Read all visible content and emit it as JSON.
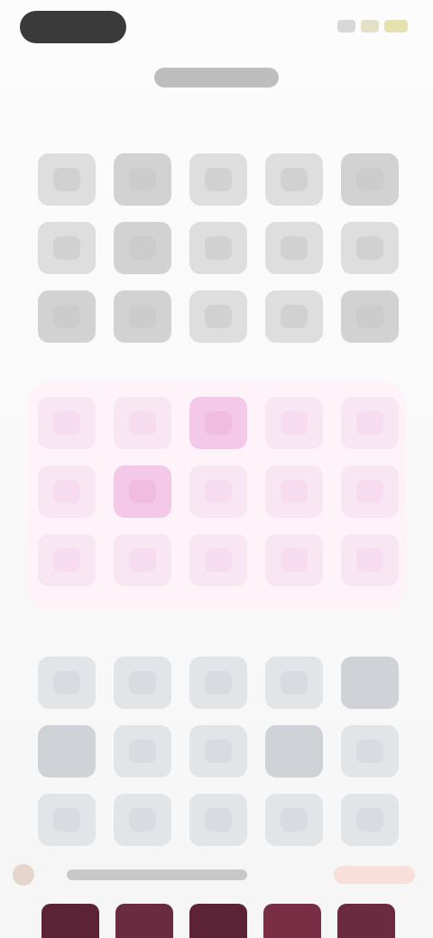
{
  "status_bar": {
    "icons": [
      "signal-icon",
      "wifi-icon",
      "battery-icon"
    ]
  },
  "header": {
    "title": ""
  },
  "sections": {
    "top_grid": {
      "tile_count": 15
    },
    "pink_grid": {
      "tile_count": 15
    },
    "bottom_grid": {
      "tile_count": 15
    }
  },
  "bottom_bar": {
    "text": "",
    "thumb_count": 5
  },
  "colors": {
    "background": "#fafafa",
    "gray_tile": "#dedede",
    "pink_tile": "#f9e6f3",
    "pink_highlight": "#f3c8e9",
    "steel_tile": "#e2e5e8",
    "maroon_thumb": "#5b2335"
  }
}
